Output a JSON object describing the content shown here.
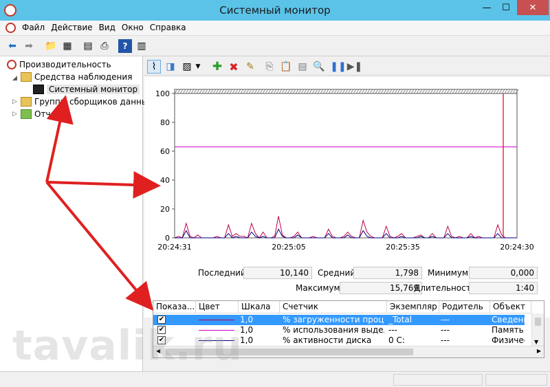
{
  "window": {
    "title": "Системный монитор",
    "min": "—",
    "max": "☐",
    "close": "✕"
  },
  "menu": [
    "Файл",
    "Действие",
    "Вид",
    "Окно",
    "Справка"
  ],
  "tree": {
    "root": "Производительность",
    "items": [
      {
        "label": "Средства наблюдения",
        "level": 1,
        "expanded": true
      },
      {
        "label": "Системный монитор",
        "level": 2,
        "selected": true
      },
      {
        "label": "Группы сборщиков данных",
        "level": 1
      },
      {
        "label": "Отчеты",
        "level": 1
      }
    ]
  },
  "chart_data": {
    "type": "line",
    "ylim": [
      0,
      100
    ],
    "yticks": [
      0,
      20,
      40,
      60,
      80,
      100
    ],
    "xticks": [
      "20:24:31",
      "20:25:05",
      "20:25:35",
      "20:24:30"
    ],
    "series": [
      {
        "color": "#c0004a",
        "values": [
          0,
          1,
          0,
          10,
          1,
          0,
          2,
          0,
          0,
          0,
          0,
          1,
          0,
          0,
          9,
          1,
          3,
          1,
          1,
          0,
          10,
          3,
          0,
          4,
          0,
          0,
          1,
          15,
          2,
          0,
          0,
          1,
          4,
          0,
          0,
          0,
          1,
          0,
          0,
          0,
          6,
          1,
          0,
          0,
          1,
          4,
          1,
          0,
          0,
          12,
          4,
          1,
          0,
          0,
          0,
          8,
          1,
          0,
          1,
          3,
          0,
          0,
          0,
          1,
          2,
          0,
          0,
          3,
          0,
          0,
          0,
          8,
          1,
          0,
          1,
          0,
          0,
          3,
          0,
          1,
          0,
          0,
          0,
          0,
          9,
          2,
          0,
          0,
          0,
          0
        ]
      },
      {
        "color": "#cc00cc",
        "values": [
          63,
          63,
          63,
          63,
          63,
          63,
          63,
          63,
          63,
          63,
          63,
          63,
          63,
          63,
          63,
          63,
          63,
          63,
          63,
          63,
          63,
          63,
          63,
          63,
          63,
          63,
          63,
          63,
          63,
          63,
          63,
          63,
          63,
          63,
          63,
          63,
          63,
          63,
          63,
          63,
          63,
          63,
          63,
          63,
          63,
          63,
          63,
          63,
          63,
          63,
          63,
          63,
          63,
          63,
          63,
          63,
          63,
          63,
          63,
          63,
          63,
          63,
          63,
          63,
          63,
          63,
          63,
          63,
          63,
          63,
          63,
          63,
          63,
          63,
          63,
          63,
          63,
          63,
          63,
          63,
          63,
          63,
          63,
          63,
          63,
          63,
          63,
          63,
          63,
          63
        ]
      },
      {
        "color": "#000080",
        "values": [
          0,
          0,
          0,
          5,
          0,
          0,
          0,
          0,
          0,
          0,
          0,
          0,
          0,
          0,
          3,
          0,
          1,
          0,
          0,
          0,
          4,
          1,
          0,
          1,
          0,
          0,
          0,
          6,
          1,
          0,
          0,
          0,
          2,
          0,
          0,
          0,
          0,
          0,
          0,
          0,
          3,
          0,
          0,
          0,
          0,
          2,
          0,
          0,
          0,
          5,
          1,
          0,
          0,
          0,
          0,
          3,
          0,
          0,
          0,
          1,
          0,
          0,
          0,
          0,
          1,
          0,
          0,
          1,
          0,
          0,
          0,
          3,
          0,
          0,
          0,
          0,
          0,
          1,
          0,
          0,
          0,
          0,
          0,
          0,
          3,
          0,
          0,
          0,
          0,
          0
        ]
      }
    ]
  },
  "stats": {
    "last_label": "Последний",
    "last": "10,140",
    "avg_label": "Средний",
    "avg": "1,798",
    "min_label": "Минимум",
    "min": "0,000",
    "max_label": "Максимум",
    "max": "15,769",
    "dur_label": "Длительность",
    "dur": "1:40"
  },
  "counters": {
    "headers": [
      "Показа...",
      "Цвет",
      "Шкала",
      "Счетчик",
      "Экземпляр",
      "Родитель",
      "Объект"
    ],
    "rows": [
      {
        "color": "#c0004a",
        "scale": "1,0",
        "counter": "% загруженности проце...",
        "instance": "_Total",
        "parent": "---",
        "object": "Сведени",
        "selected": true
      },
      {
        "color": "#cc00cc",
        "scale": "1,0",
        "counter": "% использования выдел...",
        "instance": "---",
        "parent": "---",
        "object": "Память"
      },
      {
        "color": "#000080",
        "scale": "1,0",
        "counter": "% активности диска",
        "instance": "0 C:",
        "parent": "---",
        "object": "Физичес"
      }
    ]
  },
  "watermark": "tavalik.ru"
}
